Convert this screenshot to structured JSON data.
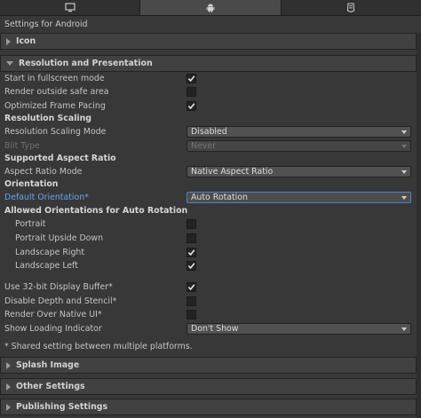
{
  "tabs": [
    {
      "icon": "monitor-icon",
      "active": false
    },
    {
      "icon": "android-icon",
      "active": true
    },
    {
      "icon": "webgl-icon",
      "active": false
    }
  ],
  "settings_title": "Settings for Android",
  "sections": {
    "icon": "Icon",
    "resolution": "Resolution and Presentation",
    "splash": "Splash Image",
    "other": "Other Settings",
    "publishing": "Publishing Settings"
  },
  "resolution": {
    "start_fullscreen": {
      "label": "Start in fullscreen mode",
      "checked": true
    },
    "render_outside_safe": {
      "label": "Render outside safe area",
      "checked": false
    },
    "optimized_pacing": {
      "label": "Optimized Frame Pacing",
      "checked": true
    },
    "scaling_heading": "Resolution Scaling",
    "scaling_mode": {
      "label": "Resolution Scaling Mode",
      "value": "Disabled"
    },
    "blit_type": {
      "label": "Blit Type",
      "value": "Never"
    },
    "aspect_heading": "Supported Aspect Ratio",
    "aspect_mode": {
      "label": "Aspect Ratio Mode",
      "value": "Native Aspect Ratio"
    },
    "orientation_heading": "Orientation",
    "default_orientation": {
      "label": "Default Orientation*",
      "value": "Auto Rotation"
    },
    "allowed_heading": "Allowed Orientations for Auto Rotation",
    "portrait": {
      "label": "Portrait",
      "checked": false
    },
    "portrait_upside_down": {
      "label": "Portrait Upside Down",
      "checked": false
    },
    "landscape_right": {
      "label": "Landscape Right",
      "checked": true
    },
    "landscape_left": {
      "label": "Landscape Left",
      "checked": true
    },
    "display_buffer": {
      "label": "Use 32-bit Display Buffer*",
      "checked": true
    },
    "disable_depth": {
      "label": "Disable Depth and Stencil*",
      "checked": false
    },
    "render_over_native": {
      "label": "Render Over Native UI*",
      "checked": false
    },
    "loading_indicator": {
      "label": "Show Loading Indicator",
      "value": "Don't Show"
    },
    "shared_note": "* Shared setting between multiple platforms."
  }
}
